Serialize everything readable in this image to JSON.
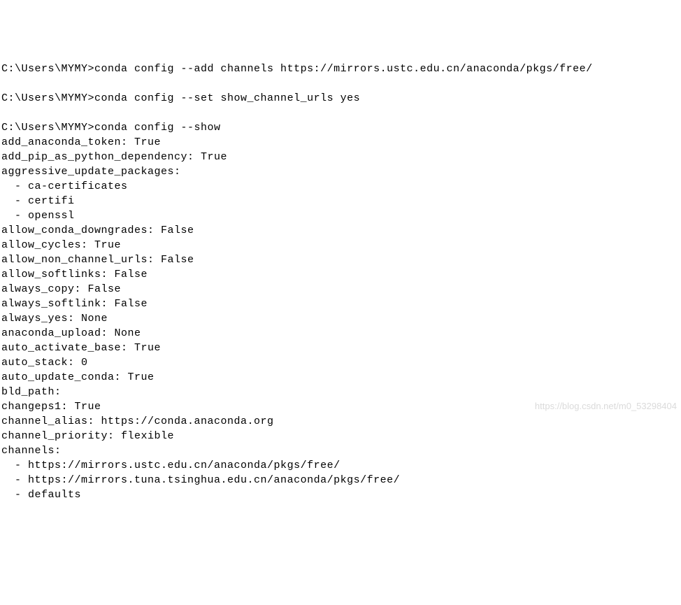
{
  "terminal": {
    "lines": [
      "C:\\Users\\MYMY>conda config --add channels https://mirrors.ustc.edu.cn/anaconda/pkgs/free/",
      "",
      "C:\\Users\\MYMY>conda config --set show_channel_urls yes",
      "",
      "C:\\Users\\MYMY>conda config --show",
      "add_anaconda_token: True",
      "add_pip_as_python_dependency: True",
      "aggressive_update_packages:",
      "  - ca-certificates",
      "  - certifi",
      "  - openssl",
      "allow_conda_downgrades: False",
      "allow_cycles: True",
      "allow_non_channel_urls: False",
      "allow_softlinks: False",
      "always_copy: False",
      "always_softlink: False",
      "always_yes: None",
      "anaconda_upload: None",
      "auto_activate_base: True",
      "auto_stack: 0",
      "auto_update_conda: True",
      "bld_path:",
      "changeps1: True",
      "channel_alias: https://conda.anaconda.org",
      "channel_priority: flexible",
      "channels:",
      "  - https://mirrors.ustc.edu.cn/anaconda/pkgs/free/",
      "  - https://mirrors.tuna.tsinghua.edu.cn/anaconda/pkgs/free/",
      "  - defaults"
    ]
  },
  "watermark": "https://blog.csdn.net/m0_53298404"
}
